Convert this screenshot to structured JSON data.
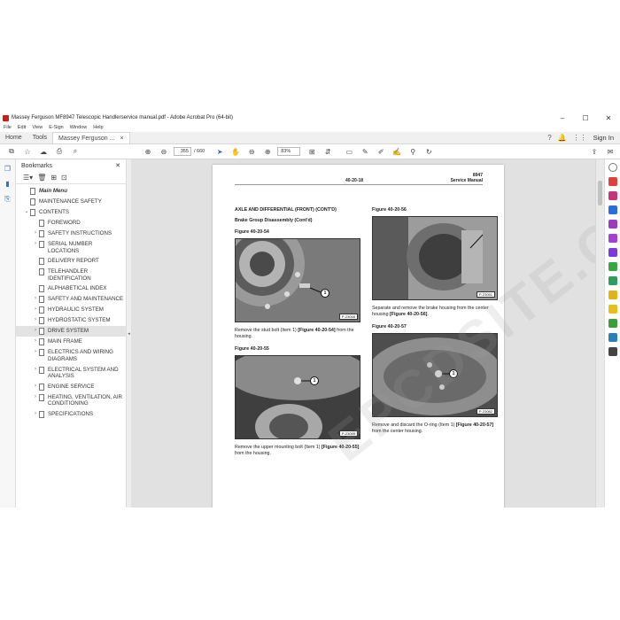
{
  "window": {
    "title": "Massey Ferguson MF8947 Telescopic Handlerservice manual.pdf - Adobe Acrobat Pro (64-bit)",
    "controls": [
      "–",
      "☐",
      "✕"
    ]
  },
  "menu": [
    "File",
    "Edit",
    "View",
    "E-Sign",
    "Window",
    "Help"
  ],
  "tabs": {
    "home": "Home",
    "tools": "Tools",
    "document": "Massey Ferguson ...",
    "close": "×",
    "sign_in": "Sign In"
  },
  "toolbar": {
    "page_current": "355",
    "page_total": "/ 660",
    "zoom": "83%"
  },
  "bookmarks": {
    "title": "Bookmarks",
    "close": "✕",
    "items": [
      {
        "label": "Main Menu",
        "level": 0,
        "expandable": false,
        "italic": true
      },
      {
        "label": "MAINTENANCE SAFETY",
        "level": 0,
        "expandable": false
      },
      {
        "label": "CONTENTS",
        "level": 0,
        "expandable": true,
        "expanded": true
      },
      {
        "label": "FOREWORD",
        "level": 1,
        "expandable": false
      },
      {
        "label": "SAFETY INSTRUCTIONS",
        "level": 1,
        "expandable": true
      },
      {
        "label": "SERIAL NUMBER LOCATIONS",
        "level": 1,
        "expandable": true
      },
      {
        "label": "DELIVERY REPORT",
        "level": 1,
        "expandable": false
      },
      {
        "label": "TELEHANDLER IDENTIFICATION",
        "level": 1,
        "expandable": false
      },
      {
        "label": "ALPHABETICAL INDEX",
        "level": 1,
        "expandable": false
      },
      {
        "label": "SAFETY AND MAINTENANCE",
        "level": 1,
        "expandable": true
      },
      {
        "label": "HYDRAULIC SYSTEM",
        "level": 1,
        "expandable": true
      },
      {
        "label": "HYDROSTATIC SYSTEM",
        "level": 1,
        "expandable": true
      },
      {
        "label": "DRIVE SYSTEM",
        "level": 1,
        "expandable": true,
        "selected": true
      },
      {
        "label": "MAIN FRAME",
        "level": 1,
        "expandable": true
      },
      {
        "label": "ELECTRICS AND WIRING DIAGRAMS",
        "level": 1,
        "expandable": true
      },
      {
        "label": "ELECTRICAL SYSTEM AND ANALYSIS",
        "level": 1,
        "expandable": true
      },
      {
        "label": "ENGINE SERVICE",
        "level": 1,
        "expandable": true
      },
      {
        "label": "HEATING, VENTILATION, AIR CONDITIONING",
        "level": 1,
        "expandable": true
      },
      {
        "label": "SPECIFICATIONS",
        "level": 1,
        "expandable": true
      }
    ]
  },
  "page": {
    "model": "8947",
    "page_number": "40-20-18",
    "manual": "Service Manual",
    "section_title": "AXLE AND DIFFERENTIAL (FRONT) (CONT'D)",
    "subsection": "Brake Group Disassembly (Cont'd)",
    "fig54": {
      "caption": "Figure 40-20-54",
      "code": "P-23048",
      "text_a": "Remove the stud bolt (Item 1) ",
      "ref": "[Figure 40-20-54]",
      "text_b": " from the housing."
    },
    "fig55": {
      "caption": "Figure 40-20-55",
      "code": "P-23049",
      "text_a": "Remove the upper mounting bolt (Item 1) ",
      "ref": "[Figure 40-20-55]",
      "text_b": " from the housing."
    },
    "fig56": {
      "caption": "Figure 40-20-56",
      "code": "P-23051",
      "text_a": "Separate and remove the brake housing from the center housing ",
      "ref": "[Figure 40-20-56]",
      "text_b": "."
    },
    "fig57": {
      "caption": "Figure 40-20-57",
      "code": "P-23082",
      "text_a": "Remove and discard the O-ring (Item 1) ",
      "ref": "[Figure 40-20-57]",
      "text_b": " from the center housing."
    },
    "callout": "1"
  },
  "watermark": "EPCDSITE.COM",
  "colors": {
    "acrobat_red": "#c8201b",
    "accent_blue": "#2b6fd6",
    "selected_bg": "#e3e3e3"
  }
}
